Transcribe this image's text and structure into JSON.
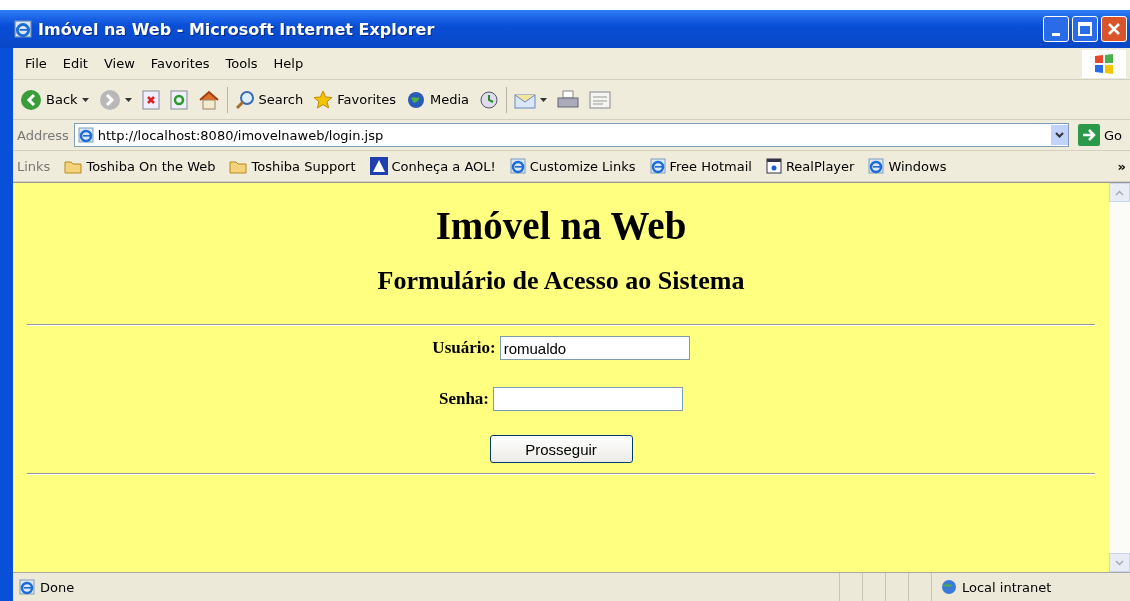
{
  "window": {
    "title": "Imóvel na Web - Microsoft Internet Explorer"
  },
  "menu": [
    "File",
    "Edit",
    "View",
    "Favorites",
    "Tools",
    "Help"
  ],
  "toolbar": [
    {
      "kind": "back",
      "label": "Back"
    },
    {
      "kind": "forward"
    },
    {
      "kind": "stop"
    },
    {
      "kind": "refresh"
    },
    {
      "kind": "home"
    },
    {
      "kind": "search",
      "label": "Search"
    },
    {
      "kind": "favorites",
      "label": "Favorites"
    },
    {
      "kind": "media",
      "label": "Media"
    },
    {
      "kind": "history"
    },
    {
      "kind": "mail"
    },
    {
      "kind": "print"
    },
    {
      "kind": "edit"
    }
  ],
  "address": {
    "label": "Address",
    "value": "http://localhost:8080/imovelnaweb/login.jsp",
    "go": "Go"
  },
  "links": {
    "label": "Links",
    "items": [
      {
        "kind": "folder",
        "label": "Toshiba On the Web"
      },
      {
        "kind": "folder",
        "label": "Toshiba Support"
      },
      {
        "kind": "aol",
        "label": "Conheça a AOL!"
      },
      {
        "kind": "ie",
        "label": "Customize Links"
      },
      {
        "kind": "ie",
        "label": "Free Hotmail"
      },
      {
        "kind": "real",
        "label": "RealPlayer"
      },
      {
        "kind": "ie",
        "label": "Windows"
      }
    ],
    "more": "»"
  },
  "page": {
    "heading": "Imóvel na Web",
    "subheading": "Formulário de Acesso ao Sistema",
    "fields": [
      {
        "label": "Usuário:",
        "value": "romualdo"
      },
      {
        "label": "Senha:"
      }
    ],
    "button": "Prosseguir"
  },
  "status_bar": {
    "text": "Done",
    "zone": "Local intranet"
  }
}
